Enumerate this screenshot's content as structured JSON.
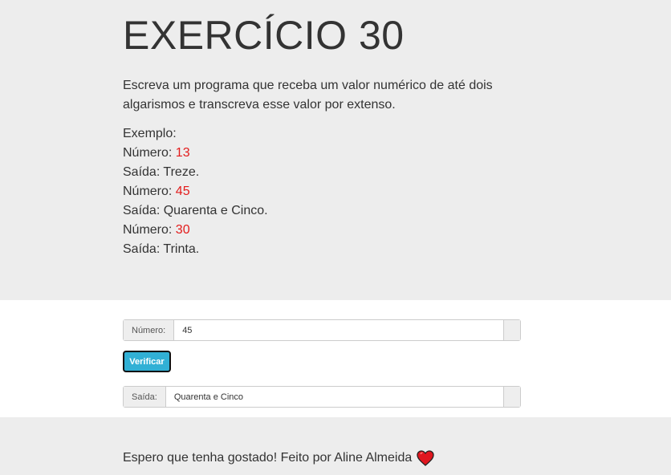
{
  "header": {
    "title": "EXERCÍCIO 30",
    "description": "Escreva um programa que receba um valor numérico de até dois algarismos e transcreva esse valor por extenso."
  },
  "examples": {
    "label": "Exemplo:",
    "items": [
      {
        "number_label": "Número: ",
        "number": "13",
        "output": "Saída: Treze."
      },
      {
        "number_label": "Número: ",
        "number": "45",
        "output": "Saída: Quarenta e Cinco."
      },
      {
        "number_label": "Número: ",
        "number": "30",
        "output": "Saída: Trinta."
      }
    ]
  },
  "form": {
    "number_label": "Número:",
    "number_value": "45",
    "button_label": "Verificar",
    "output_label": "Saída:",
    "output_value": "Quarenta e Cinco"
  },
  "footer": {
    "text": "Espero que tenha gostado! Feito por Aline Almeida",
    "icon": "heart-icon"
  },
  "colors": {
    "highlight": "#e31b1b",
    "button": "#31b0d5",
    "heart": "#e0161f"
  }
}
